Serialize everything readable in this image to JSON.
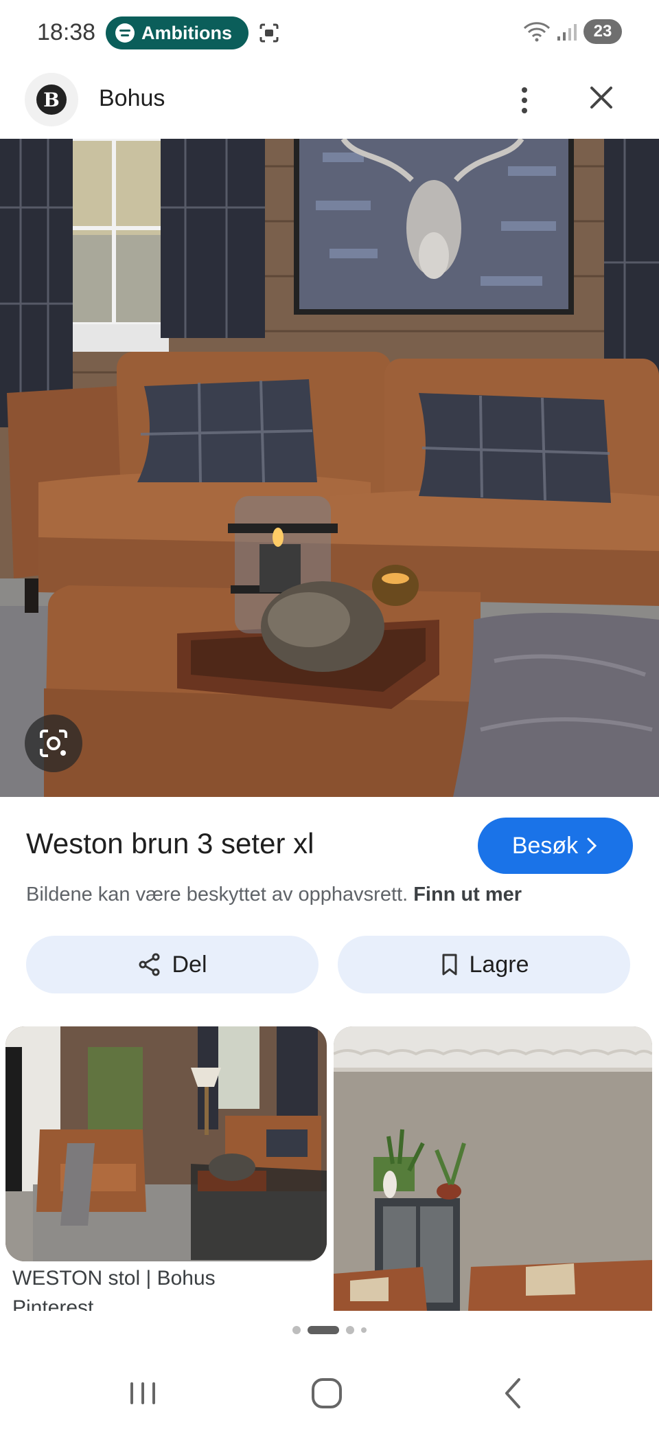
{
  "status_bar": {
    "time": "18:38",
    "media_label": "Ambitions",
    "battery": "23"
  },
  "header": {
    "brand_logo_letter": "B",
    "site_name": "Bohus"
  },
  "product": {
    "title": "Weston brun 3 seter xl",
    "visit_label": "Besøk",
    "copyright_text": "Bildene kan være beskyttet av opphavsrett.",
    "copyright_link": "Finn ut mer"
  },
  "actions": {
    "share_label": "Del",
    "save_label": "Lagre"
  },
  "related": {
    "card1_title": "WESTON stol | Bohus",
    "card1_source": "Pinterest"
  },
  "pagination": {
    "active_index": 1,
    "count": 4
  },
  "colors": {
    "accent": "#1a73e8",
    "media_pill": "#0b5e5a",
    "chip_bg": "#e8effb"
  }
}
